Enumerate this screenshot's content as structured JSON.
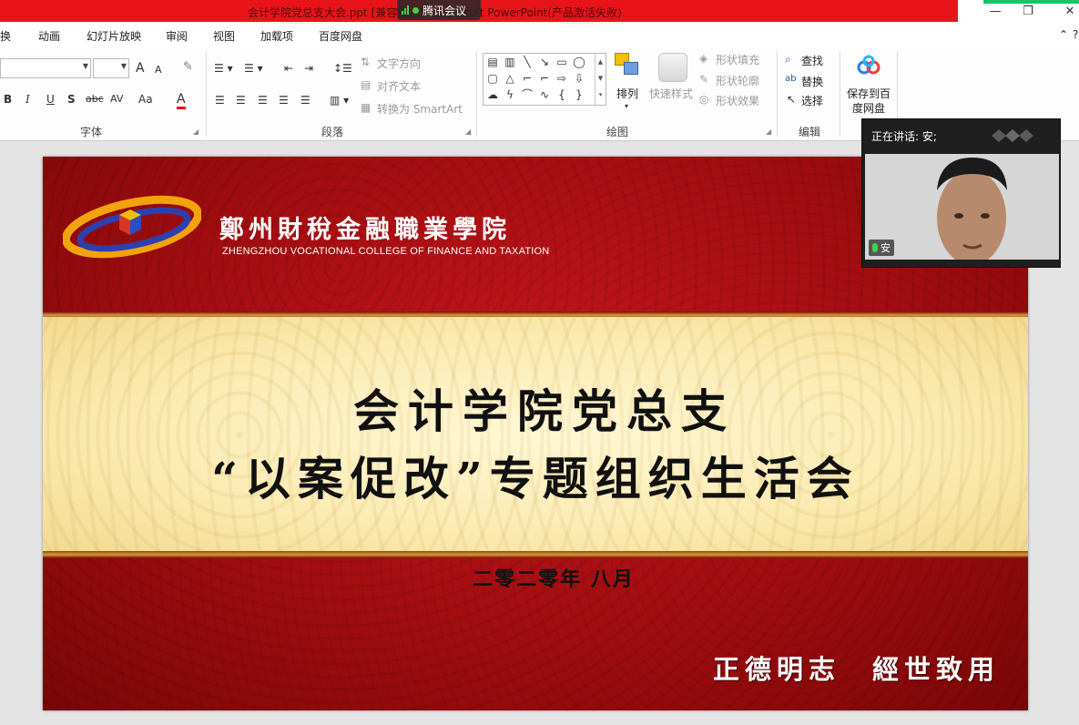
{
  "titlebar": {
    "title": "会计学院党总支大会.ppt [兼容模式] - Microsoft PowerPoint(产品激活失败)",
    "meeting_app": "腾讯会议",
    "minimize": "—",
    "restore": "❐",
    "close": "✕"
  },
  "menu": {
    "items": [
      "换",
      "动画",
      "幻灯片放映",
      "审阅",
      "视图",
      "加载项",
      "百度网盘"
    ],
    "collapse": "⌃",
    "help": "?"
  },
  "ribbon": {
    "font_group": {
      "label": "字体",
      "grow": "A",
      "shrink": "A",
      "bold": "B",
      "italic": "I",
      "underline": "U",
      "shadow": "S",
      "strike": "abc",
      "spacing": "AV",
      "case": "Aa",
      "color": "A"
    },
    "paragraph_group": {
      "label": "段落",
      "text_direction": "文字方向",
      "align_text": "对齐文本",
      "convert_smartart": "转换为 SmartArt"
    },
    "drawing_group": {
      "label": "绘图",
      "arrange": "排列",
      "quick_styles": "快速样式",
      "shape_fill": "形状填充",
      "shape_outline": "形状轮廓",
      "shape_effects": "形状效果"
    },
    "editing_group": {
      "label": "编辑",
      "find": "查找",
      "replace": "替换",
      "select": "选择"
    },
    "baidu_group": {
      "save_line1": "保存到百",
      "save_line2": "度网盘"
    }
  },
  "slide": {
    "college_cn": "鄭州財稅金融職業學院",
    "college_en": "ZHENGZHOU VOCATIONAL COLLEGE OF FINANCE AND TAXATION",
    "title_line1": "会计学院党总支",
    "title_line2": "“以案促改”专题组织生活会",
    "date": "二零二零年 八月",
    "motto": "正德明志　經世致用"
  },
  "video": {
    "speaking": "正在讲话: 安;",
    "participant": "安"
  },
  "colors": {
    "titlebar_red": "#e8141a",
    "slide_red": "#a10d10",
    "band_cream": "#fbeab0",
    "meeting_green": "#3fd24a"
  }
}
